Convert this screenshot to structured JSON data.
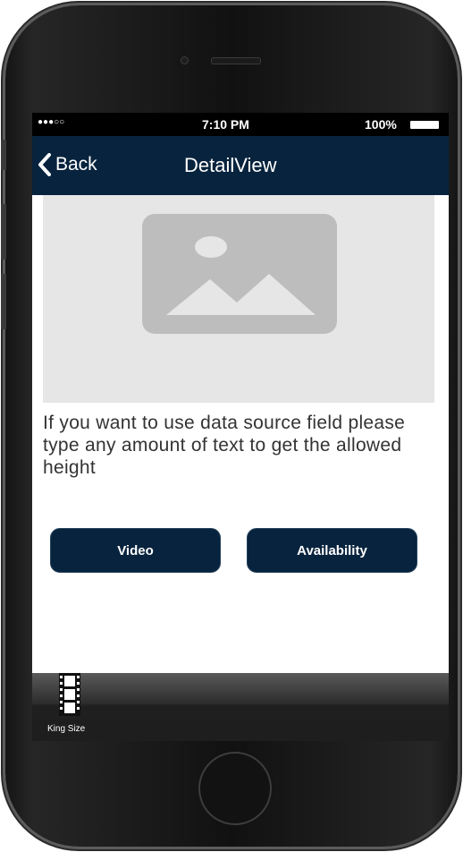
{
  "status_bar": {
    "signal": "●●●○○",
    "time": "7:10 PM",
    "battery": "100%"
  },
  "nav_bar": {
    "back_label": "Back",
    "title": "DetailView"
  },
  "content": {
    "image_icon": "image-placeholder-icon",
    "description": "If you want to use data source field please type any amount of text to get the allowed height"
  },
  "buttons": {
    "video": "Video",
    "availability": "Availability"
  },
  "tab_bar": {
    "items": [
      {
        "label": "King Size",
        "icon": "film-icon"
      }
    ]
  },
  "colors": {
    "nav_background": "#08233d",
    "button_background": "#08233d",
    "image_background": "#e6e6e6",
    "image_icon": "#bdbdbd"
  }
}
